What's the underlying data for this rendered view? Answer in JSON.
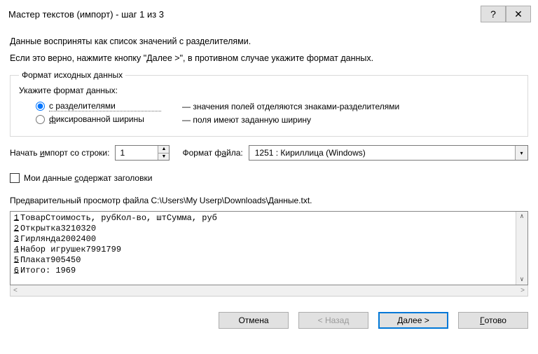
{
  "title": "Мастер текстов (импорт) - шаг 1 из 3",
  "intro_line1": "Данные восприняты как список значений с разделителями.",
  "intro_line2": "Если это верно, нажмите кнопку \"Далее >\", в противном случае укажите формат данных.",
  "format_group": {
    "legend": "Формат исходных данных",
    "subhead": "Укажите формат данных:",
    "radio1_prefix": "с раз",
    "radio1_und": "д",
    "radio1_suffix": "елителями",
    "radio1_desc": "— значения полей отделяются знаками-разделителями",
    "radio2_und": "ф",
    "radio2_suffix": "иксированной ширины",
    "radio2_desc": "— поля имеют заданную ширину",
    "selected": "delimited"
  },
  "start_row": {
    "label_prefix": "Начать ",
    "label_und": "и",
    "label_suffix": "мпорт со строки:",
    "value": "1"
  },
  "file_format": {
    "label_prefix": "Формат ф",
    "label_und": "а",
    "label_suffix": "йла:",
    "value": "1251 : Кириллица (Windows)"
  },
  "headers_cb": {
    "label_prefix": "Мои данные ",
    "label_und": "с",
    "label_suffix": "одержат заголовки",
    "checked": false
  },
  "preview": {
    "label": "Предварительный просмотр файла C:\\Users\\My Userp\\Downloads\\Данные.txt.",
    "lines": [
      "ТоварСтоимость, рубКол-во, штСумма, руб",
      "Открытка3210320",
      "Гирлянда2002400",
      "Набор игрушек7991799",
      "Плакат905450",
      "Итого: 1969"
    ]
  },
  "buttons": {
    "cancel": "Отмена",
    "back": "< Назад",
    "next": "Далее >",
    "finish_und": "Г",
    "finish_suffix": "отово"
  }
}
